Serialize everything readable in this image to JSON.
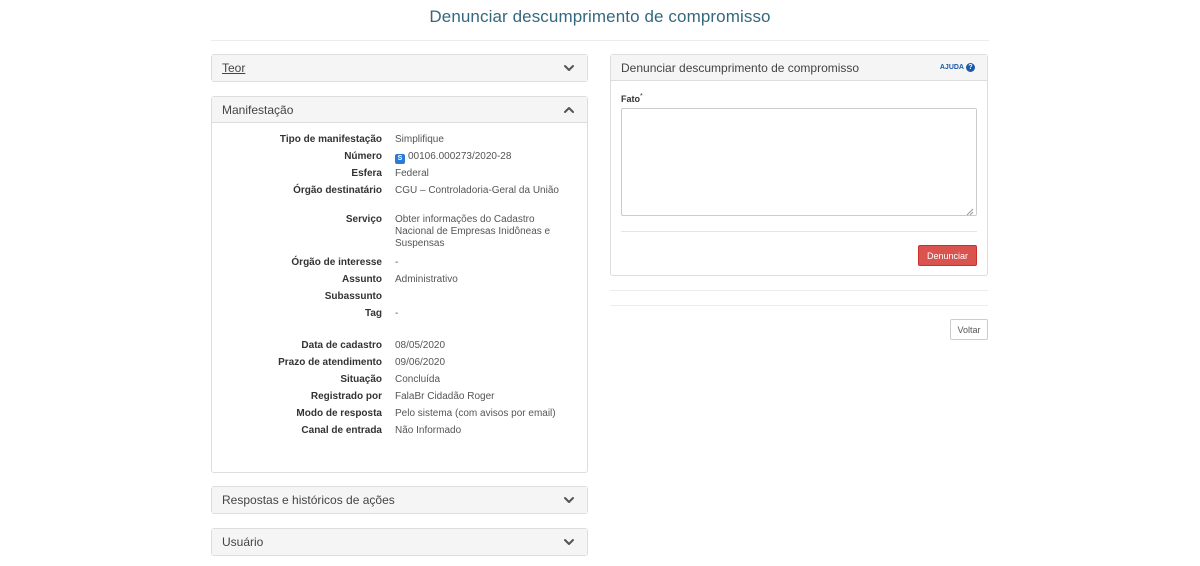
{
  "page": {
    "title": "Denunciar descumprimento de compromisso"
  },
  "panels": {
    "teor": {
      "title": "Teor"
    },
    "manifestacao": {
      "title": "Manifestação",
      "fields": [
        {
          "label": "Tipo de manifestação",
          "value": "Simplifique"
        },
        {
          "label": "Número",
          "badge": "S",
          "value": "00106.000273/2020-28"
        },
        {
          "label": "Esfera",
          "value": "Federal"
        },
        {
          "label": "Órgão destinatário",
          "value": "CGU – Controladoria-Geral da União"
        },
        {
          "label": "Serviço",
          "value": "Obter informações do Cadastro Nacional de Empresas Inidôneas e Suspensas"
        },
        {
          "label": "Órgão de interesse",
          "value": "-"
        },
        {
          "label": "Assunto",
          "value": "Administrativo"
        },
        {
          "label": "Subassunto",
          "value": ""
        },
        {
          "label": "Tag",
          "value": "-"
        },
        {
          "label": "Data de cadastro",
          "value": "08/05/2020"
        },
        {
          "label": "Prazo de atendimento",
          "value": "09/06/2020"
        },
        {
          "label": "Situação",
          "value": "Concluída"
        },
        {
          "label": "Registrado por",
          "value": "FalaBr Cidadão Roger"
        },
        {
          "label": "Modo de resposta",
          "value": "Pelo sistema (com avisos por email)"
        },
        {
          "label": "Canal de entrada",
          "value": "Não Informado"
        }
      ]
    },
    "respostas": {
      "title": "Respostas e históricos de ações"
    },
    "usuario": {
      "title": "Usuário"
    }
  },
  "form": {
    "title": "Denunciar descumprimento de compromisso",
    "help_label": "AJUDA",
    "fato_label": "Fato",
    "fato_required": "*",
    "fato_value": "",
    "submit_label": "Denunciar"
  },
  "back_label": "Voltar",
  "colors": {
    "title": "#34687f",
    "danger": "#d9534f",
    "badge": "#2c7ad6",
    "help": "#1a5aa8"
  }
}
